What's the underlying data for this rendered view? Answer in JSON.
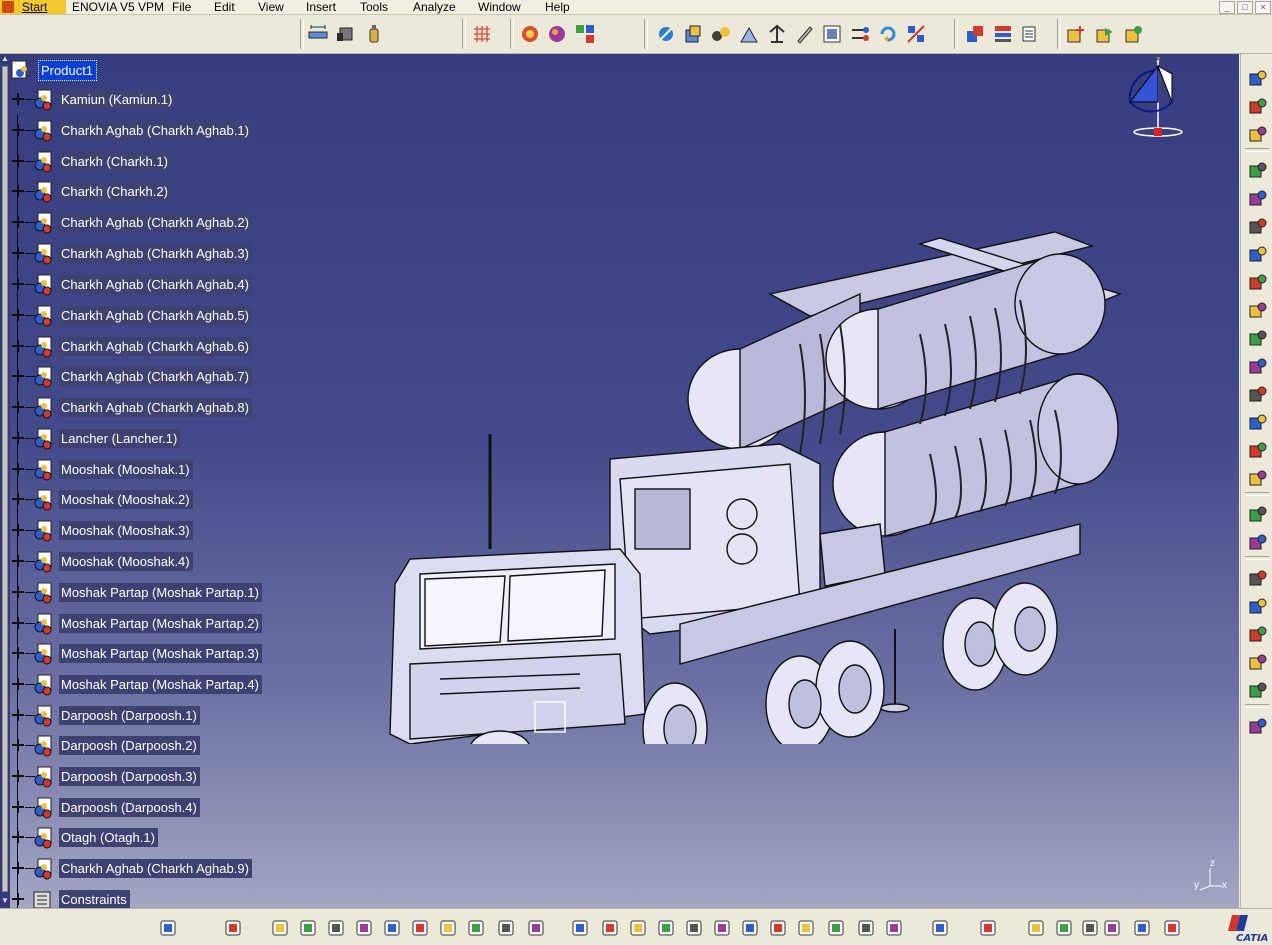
{
  "menubar": {
    "start": "Start",
    "items": [
      "ENOVIA V5 VPM",
      "File",
      "Edit",
      "View",
      "Insert",
      "Tools",
      "Analyze",
      "Window",
      "Help"
    ],
    "window_controls": [
      "_",
      "□",
      "×"
    ]
  },
  "tree": {
    "root": "Product1",
    "items": [
      "Kamiun (Kamiun.1)",
      "Charkh Aghab (Charkh Aghab.1)",
      "Charkh (Charkh.1)",
      "Charkh (Charkh.2)",
      "Charkh Aghab (Charkh Aghab.2)",
      "Charkh Aghab (Charkh Aghab.3)",
      "Charkh Aghab (Charkh Aghab.4)",
      "Charkh Aghab (Charkh Aghab.5)",
      "Charkh Aghab (Charkh Aghab.6)",
      "Charkh Aghab (Charkh Aghab.7)",
      "Charkh Aghab (Charkh Aghab.8)",
      "Lancher (Lancher.1)",
      "Mooshak (Mooshak.1)",
      "Mooshak (Mooshak.2)",
      "Mooshak (Mooshak.3)",
      "Mooshak (Mooshak.4)",
      "Moshak Partap (Moshak Partap.1)",
      "Moshak Partap (Moshak Partap.2)",
      "Moshak Partap (Moshak Partap.3)",
      "Moshak Partap (Moshak Partap.4)",
      "Darpoosh (Darpoosh.1)",
      "Darpoosh (Darpoosh.2)",
      "Darpoosh (Darpoosh.3)",
      "Darpoosh (Darpoosh.4)",
      "Otagh (Otagh.1)",
      "Charkh Aghab (Charkh Aghab.9)"
    ],
    "constraints": "Constraints"
  },
  "axis": {
    "x": "x",
    "y": "y",
    "z": "z"
  },
  "brand": {
    "logo_text": "CATIA"
  },
  "icons": {
    "top": [
      "measure-icon",
      "measure-inertia-icon",
      "bottle-icon",
      "grid-snap-icon",
      "fast-multi-instantiation-icon",
      "style-icon",
      "apply-material-icon",
      "hide-show-icon",
      "explode-icon",
      "assembly-features-icon",
      "bulk-icon",
      "catalog-icon",
      "generate-icon",
      "scenes-icon",
      "update-icon",
      "manipulation-icon",
      "smart-move-icon",
      "sectioning-icon",
      "clash-icon",
      "swap-icon",
      "new-component-icon",
      "new-product-icon",
      "new-part-icon"
    ],
    "right": [
      "performance-icon",
      "select-icon",
      "fit-icon",
      "existing-component-icon",
      "existing-component-positioning-icon",
      "replace-component-icon",
      "graph-tree-reordering-icon",
      "generate-numbering-icon",
      "selective-load-icon",
      "manage-representations-icon",
      "multi-instantiation-icon",
      "manipulation-icon",
      "snap-icon",
      "explode-icon",
      "stop-clash-icon",
      "coincidence-constraint-icon",
      "contact-constraint-icon",
      "offset-constraint-icon",
      "angle-constraint-icon",
      "fix-component-icon",
      "reuse-pattern-icon",
      "scenes-icon",
      "publication-icon"
    ],
    "bottom": [
      "product-tree-icon",
      "save-mgmt-icon",
      "new-icon",
      "open-icon",
      "save-icon",
      "print-icon",
      "cut-icon",
      "copy-icon",
      "paste-icon",
      "undo-icon",
      "redo-icon",
      "whats-this-icon",
      "fly-mode-icon",
      "fit-all-icon",
      "pan-icon",
      "rotate-icon",
      "zoom-in-icon",
      "zoom-out-icon",
      "normal-view-icon",
      "iso-view-icon",
      "shading-icon",
      "hide-show-icon",
      "swap-visible-icon",
      "update-icon",
      "capture-icon",
      "formula-icon",
      "knowledge-icon",
      "measure-tool-icon",
      "table-icon",
      "tree-expansion-icon",
      "lock-icon",
      "parameters-icon"
    ]
  },
  "colors": {
    "tree_label_bg": "#3e4270",
    "root_selected_bg": "#0a3ed8",
    "viewport_top": "#363d80",
    "viewport_bottom": "#a3a6c3",
    "model_fill": "#dcdcf0"
  }
}
